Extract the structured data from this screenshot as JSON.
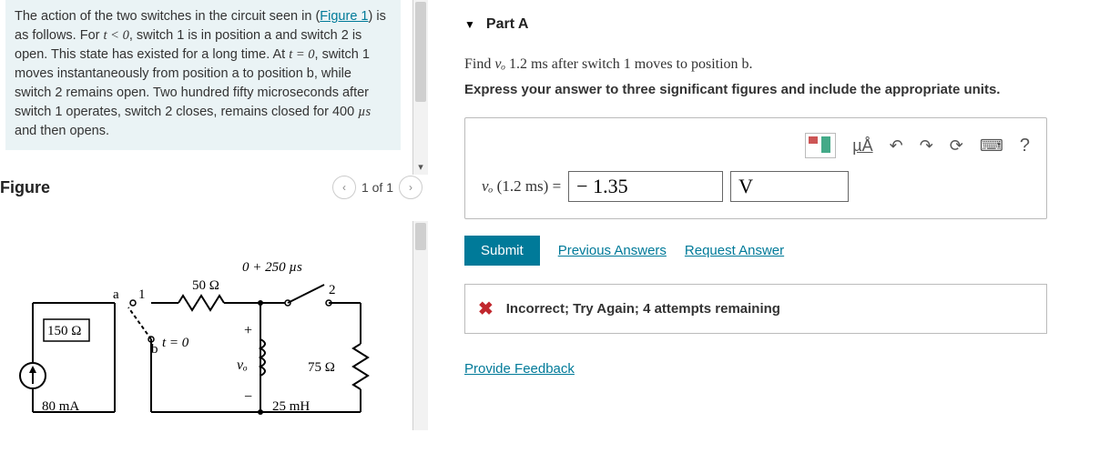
{
  "problem": {
    "pre_link": "The action of the two switches in the circuit seen in (",
    "link_text": "Figure 1",
    "post_link": ") is as follows. For ",
    "cond1_math": "t < 0",
    "mid1": ", switch 1 is in position a and switch 2 is open. This state has existed for a long time. At ",
    "cond2_math": "t = 0",
    "mid2": ", switch 1 moves instantaneously from position a to position b, while switch 2 remains open. Two hundred fifty microseconds after switch 1 operates, switch 2 closes, remains closed for 400 ",
    "unit": "µs",
    "tail": " and then opens."
  },
  "figure": {
    "title": "Figure",
    "pager": "1 of 1",
    "labels": {
      "r150": "150 Ω",
      "i80": "80 mA",
      "a": "a",
      "one": "1",
      "b": "b",
      "t0": "t = 0",
      "r50": "50 Ω",
      "sw2time": "0 + 250 µs",
      "two": "2",
      "plus": "+",
      "vo": "vₒ",
      "minus": "−",
      "l25": "25 mH",
      "r75": "75 Ω"
    }
  },
  "part": {
    "header": "Part A",
    "prompt_pre": "Find ",
    "prompt_var": "vₒ",
    "prompt_mid": " 1.2 ",
    "prompt_unit1": "ms",
    "prompt_post": " after switch 1 moves to position b.",
    "instructions": "Express your answer to three significant figures and include the appropriate units.",
    "answer_label_var": "vₒ",
    "answer_label_arg": " (1.2 ms) = ",
    "value_input": "− 1.35",
    "unit_input": "V",
    "toolbar": {
      "units_btn": "µÅ",
      "undo": "↶",
      "redo": "↷",
      "reset": "⟳",
      "keyboard": "⌨",
      "help": "?"
    },
    "submit": "Submit",
    "previous": "Previous Answers",
    "request": "Request Answer",
    "feedback": "Incorrect; Try Again; 4 attempts remaining",
    "provide_feedback": "Provide Feedback"
  }
}
